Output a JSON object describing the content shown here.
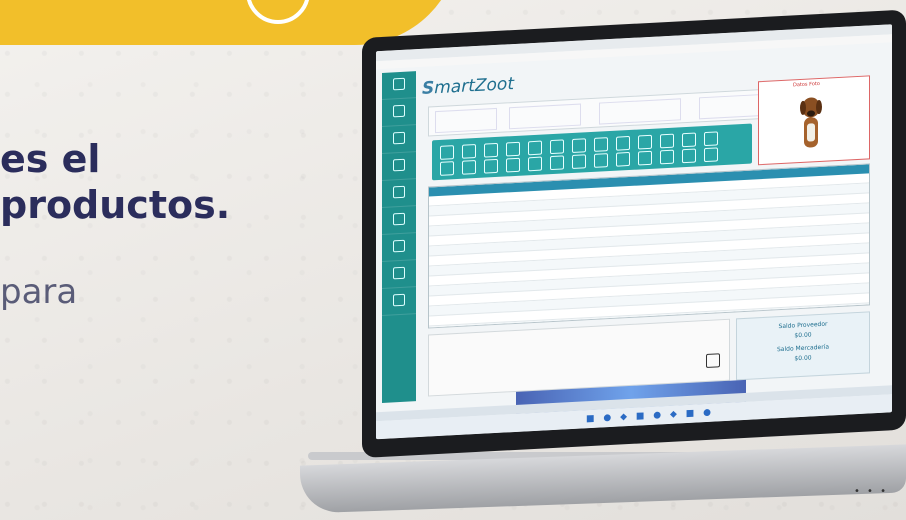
{
  "hero": {
    "headline_line1": "es el",
    "headline_line2": "productos.",
    "subline": "para"
  },
  "app": {
    "title": "SmartZoot",
    "logo_prefix": "S",
    "logo_rest": "martZoot",
    "pet_panel_title": "Datos Foto",
    "totals": {
      "label1": "Saldo Proveedor",
      "value1": "$0.00",
      "label2": "Saldo Mercadería",
      "value2": "$0.00"
    }
  },
  "colors": {
    "accent_yellow": "#f2bf2a",
    "headline_navy": "#2b2d5c",
    "app_teal": "#1f8f8c"
  }
}
